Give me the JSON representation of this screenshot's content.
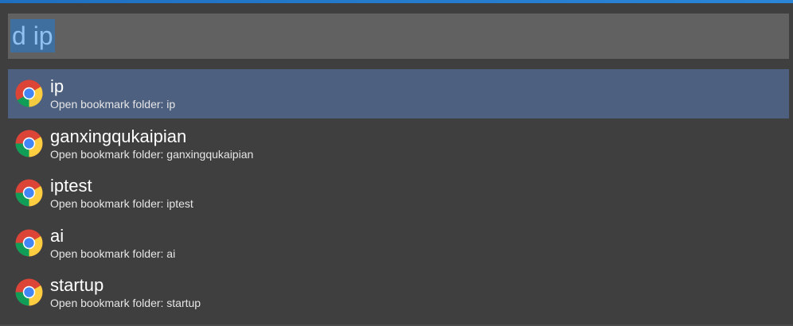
{
  "search": {
    "query": "d ip"
  },
  "results": [
    {
      "title": "ip",
      "subtitle": "Open bookmark folder: ip",
      "icon": "chrome-icon",
      "selected": true
    },
    {
      "title": "ganxingqukaipian",
      "subtitle": "Open bookmark folder: ganxingqukaipian",
      "icon": "chrome-icon",
      "selected": false
    },
    {
      "title": "iptest",
      "subtitle": "Open bookmark folder: iptest",
      "icon": "chrome-icon",
      "selected": false
    },
    {
      "title": "ai",
      "subtitle": "Open bookmark folder: ai",
      "icon": "chrome-icon",
      "selected": false
    },
    {
      "title": "startup",
      "subtitle": "Open bookmark folder: startup",
      "icon": "chrome-icon",
      "selected": false
    }
  ],
  "colors": {
    "background": "#3f3f3f",
    "search_box": "#616161",
    "selection": "#4d6080",
    "query_highlight": "#3f6f9e",
    "title_text": "#ffffff",
    "subtitle_text": "#e6e6e6"
  }
}
